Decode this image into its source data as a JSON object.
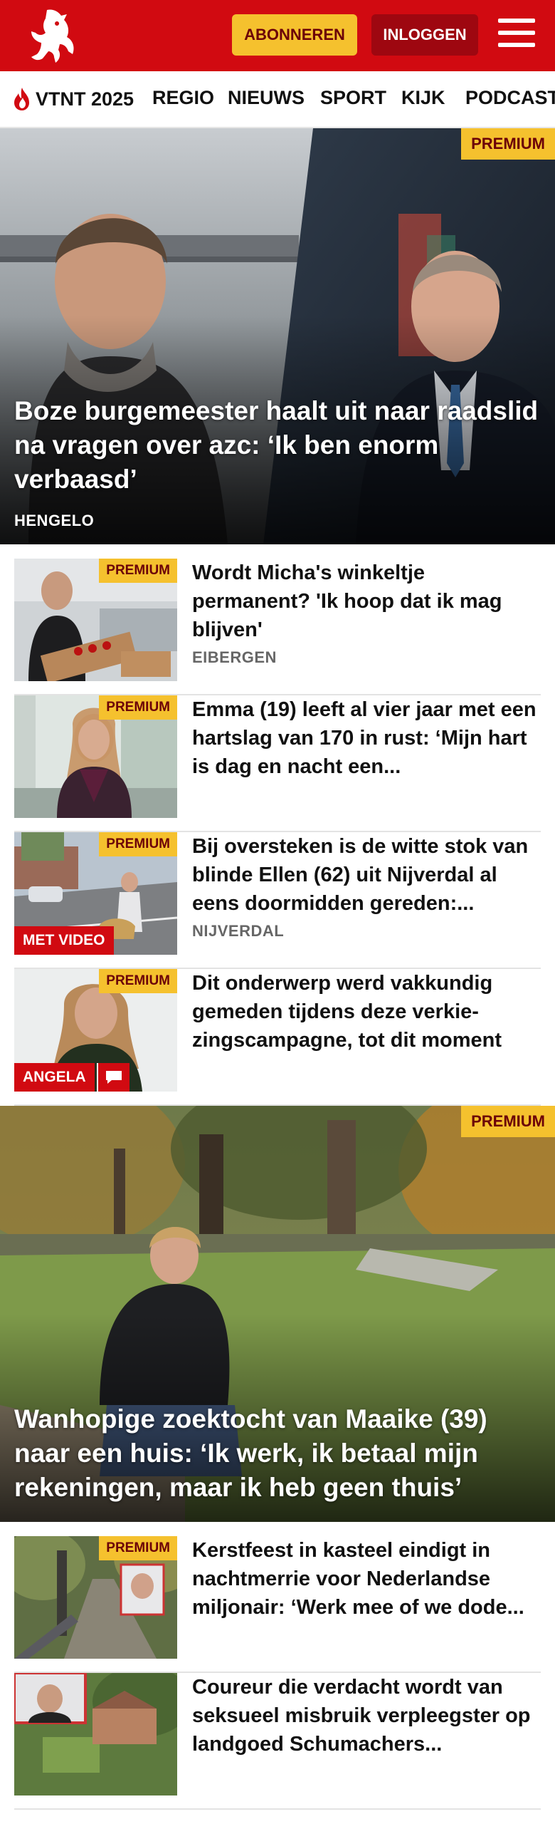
{
  "header": {
    "subscribe_label": "ABONNEREN",
    "login_label": "INLOGGEN",
    "brand_color": "#d10a11",
    "accent_color": "#f5c12e",
    "logo_icon": "horse-icon",
    "menu_icon": "hamburger-icon"
  },
  "nav": {
    "items": [
      {
        "label": "VTNT 2025",
        "icon": "flame-icon"
      },
      {
        "label": "REGIO"
      },
      {
        "label": "NIEUWS"
      },
      {
        "label": "SPORT"
      },
      {
        "label": "KIJK"
      },
      {
        "label": "PODCAST"
      }
    ]
  },
  "hero1": {
    "premium": "PREMIUM",
    "title": "Boze burgemeester haalt uit naar raadslid na vragen over azc: ‘Ik ben enorm verbaasd’",
    "location": "HENGELO"
  },
  "articles1": [
    {
      "premium": "PREMIUM",
      "title": "Wordt Micha's winkeltje permanent? 'Ik hoop dat ik mag blijven'",
      "location": "EIBERGEN"
    },
    {
      "premium": "PREMIUM",
      "title": "Emma (19) leeft al vier jaar met een hartslag van 170 in rust: ‘Mijn hart is dag en nacht een...",
      "location": ""
    },
    {
      "premium": "PREMIUM",
      "title": "Bij oversteken is de witte stok van blinde Ellen (62) uit Nijverdal al eens doormidden gereden:...",
      "location": "NIJVERDAL",
      "label": "MET VIDEO"
    },
    {
      "premium": "PREMIUM",
      "title": "Dit onderwerp werd vakkundig gemeden tijdens deze verkie­zingscampagne, tot dit moment",
      "location": "",
      "label": "ANGELA",
      "label_icon": "comment-icon"
    }
  ],
  "hero2": {
    "premium": "PREMIUM",
    "title": "Wanhopige zoektocht van Maaike (39) naar een huis: ‘Ik werk, ik betaal mijn rekeningen, maar ik heb geen thuis’"
  },
  "articles2": [
    {
      "premium": "PREMIUM",
      "title": "Kerstfeest in kasteel eindigt in nachtmerrie voor Nederlandse miljonair: ‘Werk mee of we dode..."
    },
    {
      "title": "Coureur die verdacht wordt van seksueel misbruik verpleegster op landgoed Schumachers..."
    }
  ]
}
